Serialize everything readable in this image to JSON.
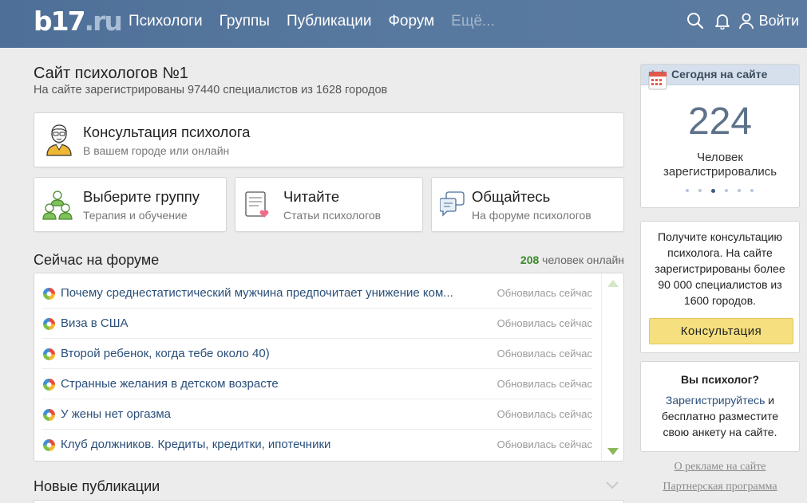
{
  "header": {
    "logo_main": "b17",
    "logo_domain": ".ru",
    "nav": [
      "Психологи",
      "Группы",
      "Публикации",
      "Форум",
      "Ещё..."
    ],
    "login_label": "Войти"
  },
  "intro": {
    "title": "Сайт психологов №1",
    "subtitle": "На сайте зарегистрированы 97440 специалистов из 1628 городов"
  },
  "cards": {
    "consult": {
      "title": "Консультация психолога",
      "subtitle": "В вашем городе или онлайн"
    },
    "group": {
      "title": "Выберите группу",
      "subtitle": "Терапия и обучение"
    },
    "read": {
      "title": "Читайте",
      "subtitle": "Статьи психологов"
    },
    "talk": {
      "title": "Общайтесь",
      "subtitle": "На форуме психологов"
    }
  },
  "forum": {
    "title": "Сейчас на форуме",
    "online_count": "208",
    "online_label": "человек онлайн",
    "rows": [
      {
        "title": "Почему среднестатистический мужчина предпочитает унижение ком...",
        "time": "Обновилась сейчас"
      },
      {
        "title": "Виза в США",
        "time": "Обновилась сейчас"
      },
      {
        "title": "Второй ребенок, когда тебе около 40)",
        "time": "Обновилась сейчас"
      },
      {
        "title": "Странные желания в детском возрасте",
        "time": "Обновилась сейчас"
      },
      {
        "title": "У жены нет оргазма",
        "time": "Обновилась сейчас"
      },
      {
        "title": "Клуб должников. Кредиты, кредитки, ипотечники",
        "time": "Обновилась сейчас"
      }
    ]
  },
  "publications": {
    "title": "Новые публикации"
  },
  "sidebar": {
    "today_title": "Сегодня на сайте",
    "today_count": "224",
    "today_caption": "Человек зарегистрировались",
    "consult_text": "Получите консультацию психолога. На сайте зарегистрированы более 90 000 специалистов из 1600 городов.",
    "consult_button": "Консультация",
    "psy_question": "Вы психолог?",
    "psy_link": "Зарегистрируйтесь",
    "psy_text": " и бесплатно разместите свою анкету на сайте.",
    "ad_link": "О рекламе на сайте",
    "partner_link": "Партнерская программа"
  },
  "colors": {
    "header": "#55769c",
    "online_green": "#3b8a2a",
    "link_blue": "#2a4f7a",
    "button_yellow": "#f5df7e"
  }
}
